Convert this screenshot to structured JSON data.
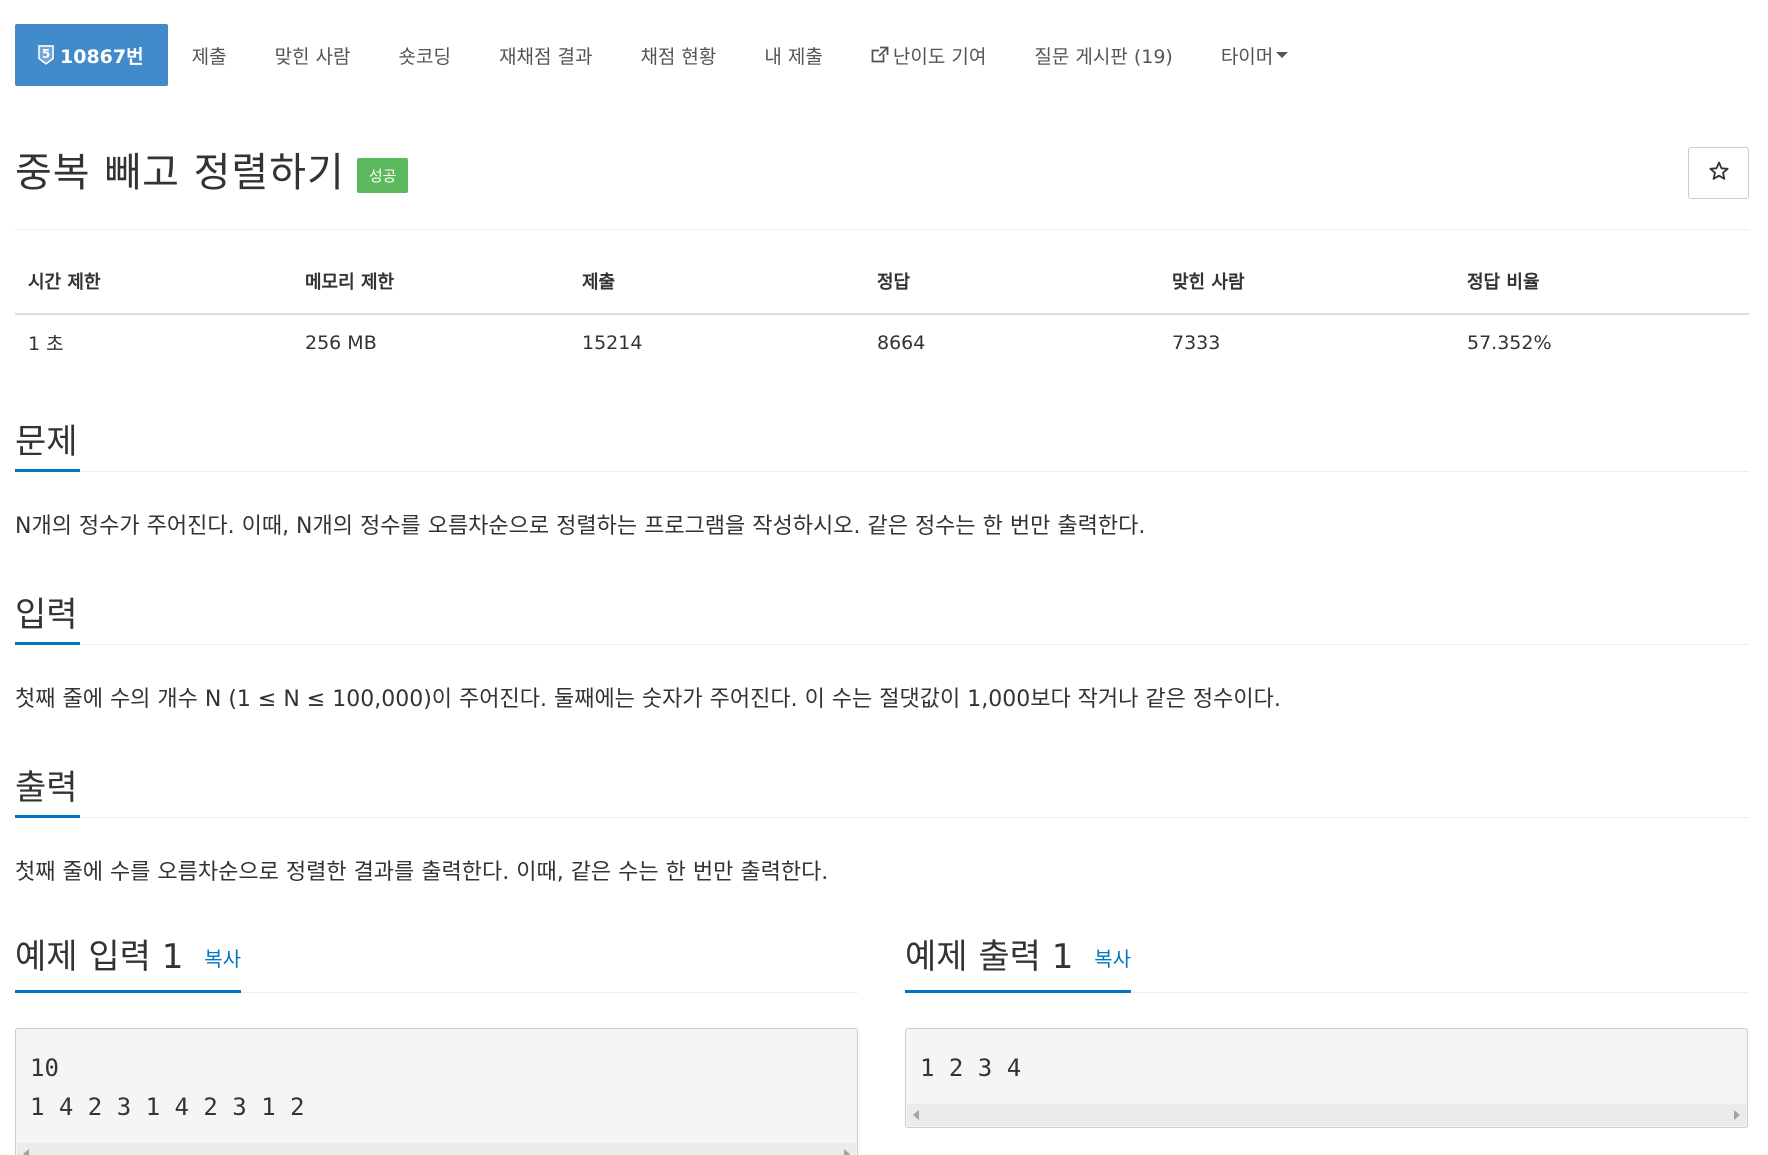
{
  "nav": {
    "problem_tier": "5",
    "problem_number": "10867번",
    "items": [
      {
        "label": "제출"
      },
      {
        "label": "맞힌 사람"
      },
      {
        "label": "숏코딩"
      },
      {
        "label": "재채점 결과"
      },
      {
        "label": "채점 현황"
      },
      {
        "label": "내 제출"
      },
      {
        "label": "난이도 기여"
      },
      {
        "label": "질문 게시판 (19)"
      },
      {
        "label": "타이머"
      }
    ]
  },
  "problem": {
    "title": "중복 빼고 정렬하기",
    "status": "성공"
  },
  "info_table": {
    "headers": [
      "시간 제한",
      "메모리 제한",
      "제출",
      "정답",
      "맞힌 사람",
      "정답 비율"
    ],
    "values": [
      "1 초",
      "256 MB",
      "15214",
      "8664",
      "7333",
      "57.352%"
    ]
  },
  "sections": {
    "description": {
      "title": "문제",
      "text": "N개의 정수가 주어진다. 이때, N개의 정수를 오름차순으로 정렬하는 프로그램을 작성하시오. 같은 정수는 한 번만 출력한다."
    },
    "input": {
      "title": "입력",
      "text": "첫째 줄에 수의 개수 N (1 ≤ N ≤ 100,000)이 주어진다. 둘째에는 숫자가 주어진다. 이 수는 절댓값이 1,000보다 작거나 같은 정수이다."
    },
    "output": {
      "title": "출력",
      "text": "첫째 줄에 수를 오름차순으로 정렬한 결과를 출력한다. 이때, 같은 수는 한 번만 출력한다."
    }
  },
  "samples": {
    "input": {
      "title": "예제 입력 1",
      "copy_label": "복사",
      "lines": [
        "10",
        "1 4 2 3 1 4 2 3 1 2"
      ]
    },
    "output": {
      "title": "예제 출력 1",
      "copy_label": "복사",
      "lines": [
        "1 2 3 4"
      ]
    }
  },
  "colors": {
    "nav_active": "#428bca",
    "success": "#5cb85c",
    "accent": "#0076c0"
  }
}
